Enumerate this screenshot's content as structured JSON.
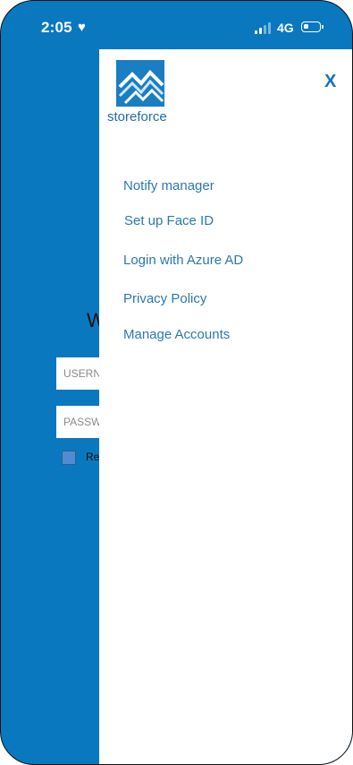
{
  "status": {
    "time": "2:05",
    "network": "4G",
    "battery_level": 0.35
  },
  "background_screen": {
    "welcome_text": "W",
    "username_placeholder": "USERN",
    "password_placeholder": "PASSW",
    "remember_text": "Re"
  },
  "drawer": {
    "logo_text": "storeforce",
    "close_label": "X",
    "menu": [
      {
        "label": "Notify manager"
      },
      {
        "label": "Set up Face ID"
      },
      {
        "label": "Login with Azure AD"
      },
      {
        "label": "Privacy Policy"
      },
      {
        "label": "Manage Accounts"
      }
    ]
  },
  "colors": {
    "brand_blue": "#0a78bf",
    "menu_text": "#2a79b0",
    "drawer_bg": "#ffffff"
  }
}
